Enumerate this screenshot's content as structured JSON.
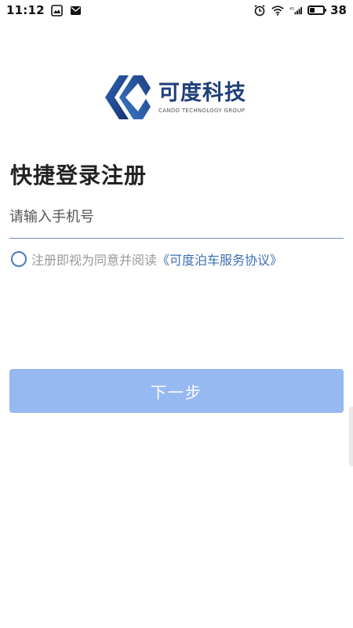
{
  "status_bar": {
    "time": "11:12",
    "battery_level": "38",
    "battery_fraction": 0.38,
    "network": "4G",
    "icons": [
      "photo-icon",
      "mail-icon",
      "alarm-icon",
      "wifi-icon",
      "signal-icon",
      "battery-icon"
    ]
  },
  "logo": {
    "name_cn": "可度科技",
    "name_en": "CANDO TECHNOLOGY GROUP",
    "brand_color": "#1f3f7a"
  },
  "page": {
    "title": "快捷登录注册"
  },
  "phone": {
    "placeholder": "请输入手机号",
    "value": "",
    "underline_color": "#6f8fbf"
  },
  "agreement": {
    "text": "注册即视为同意并阅读",
    "link": "《可度泊车服务协议》",
    "checked": false,
    "link_color": "#3d6fb4"
  },
  "next": {
    "label": "下一步",
    "color": "#97b9f2"
  }
}
